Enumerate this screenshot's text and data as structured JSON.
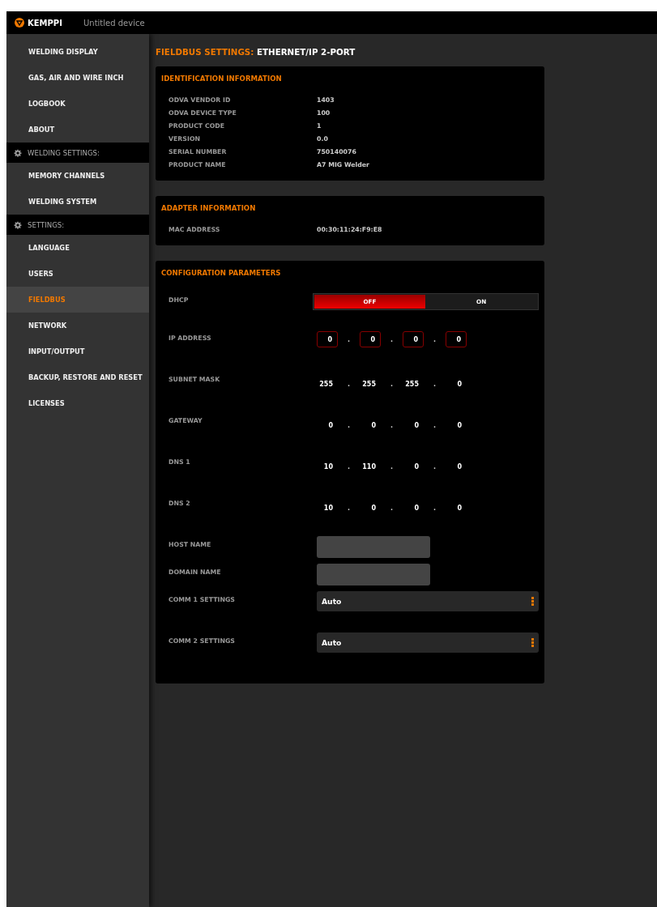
{
  "topbar": {
    "brand": "KEMPPI",
    "device": "Untitled device"
  },
  "sidebar": {
    "items": [
      {
        "kind": "item",
        "label": "WELDING DISPLAY",
        "selected": false
      },
      {
        "kind": "item",
        "label": "GAS, AIR AND WIRE INCH",
        "selected": false
      },
      {
        "kind": "item",
        "label": "LOGBOOK",
        "selected": false
      },
      {
        "kind": "item",
        "label": "ABOUT",
        "selected": false
      },
      {
        "kind": "section",
        "label": "WELDING SETTINGS:"
      },
      {
        "kind": "item",
        "label": "MEMORY CHANNELS",
        "selected": false
      },
      {
        "kind": "item",
        "label": "WELDING SYSTEM",
        "selected": false
      },
      {
        "kind": "section",
        "label": "SETTINGS:"
      },
      {
        "kind": "item",
        "label": "LANGUAGE",
        "selected": false
      },
      {
        "kind": "item",
        "label": "USERS",
        "selected": false
      },
      {
        "kind": "item",
        "label": "FIELDBUS",
        "selected": true
      },
      {
        "kind": "item",
        "label": "NETWORK",
        "selected": false
      },
      {
        "kind": "item",
        "label": "INPUT/OUTPUT",
        "selected": false
      },
      {
        "kind": "item",
        "label": "BACKUP, RESTORE AND RESET",
        "selected": false
      },
      {
        "kind": "item",
        "label": "LICENSES",
        "selected": false
      }
    ]
  },
  "page_title": {
    "prefix": "FIELDBUS SETTINGS:",
    "name": "ETHERNET/IP 2-PORT"
  },
  "identification": {
    "title": "IDENTIFICATION INFORMATION",
    "rows": [
      {
        "label": "ODVA VENDOR ID",
        "value": "1403"
      },
      {
        "label": "ODVA DEVICE TYPE",
        "value": "100"
      },
      {
        "label": "PRODUCT CODE",
        "value": "1"
      },
      {
        "label": "VERSION",
        "value": "0.0"
      },
      {
        "label": "SERIAL NUMBER",
        "value": "750140076"
      },
      {
        "label": "PRODUCT NAME",
        "value": "A7 MIG Welder"
      }
    ]
  },
  "adapter": {
    "title": "ADAPTER INFORMATION",
    "rows": [
      {
        "label": "MAC ADDRESS",
        "value": "00:30:11:24:F9:E8"
      }
    ]
  },
  "configuration": {
    "title": "CONFIGURATION PARAMETERS",
    "rows": [
      {
        "kind": "toggle",
        "label": "DHCP",
        "options": [
          {
            "label": "OFF",
            "selected": true
          },
          {
            "label": "ON",
            "selected": false
          }
        ]
      },
      {
        "kind": "ip_edit",
        "label": "IP ADDRESS",
        "separator": ".",
        "octets": [
          "0",
          "0",
          "0",
          "0"
        ]
      },
      {
        "kind": "ip",
        "label": "SUBNET MASK",
        "separator": ".",
        "octets": [
          "255",
          "255",
          "255",
          "0"
        ]
      },
      {
        "kind": "ip",
        "label": "GATEWAY",
        "separator": ".",
        "octets": [
          "0",
          "0",
          "0",
          "0"
        ]
      },
      {
        "kind": "ip",
        "label": "DNS 1",
        "separator": ".",
        "octets": [
          "10",
          "110",
          "0",
          "0"
        ]
      },
      {
        "kind": "ip",
        "label": "DNS 2",
        "separator": ".",
        "octets": [
          "10",
          "0",
          "0",
          "0"
        ]
      },
      {
        "kind": "text_field",
        "label": "HOST NAME"
      },
      {
        "kind": "text_field",
        "label": "DOMAIN NAME"
      },
      {
        "kind": "select",
        "label": "COMM 1 SETTINGS",
        "value": "Auto"
      },
      {
        "kind": "select",
        "label": "COMM 2 SETTINGS",
        "value": "Auto"
      }
    ]
  }
}
